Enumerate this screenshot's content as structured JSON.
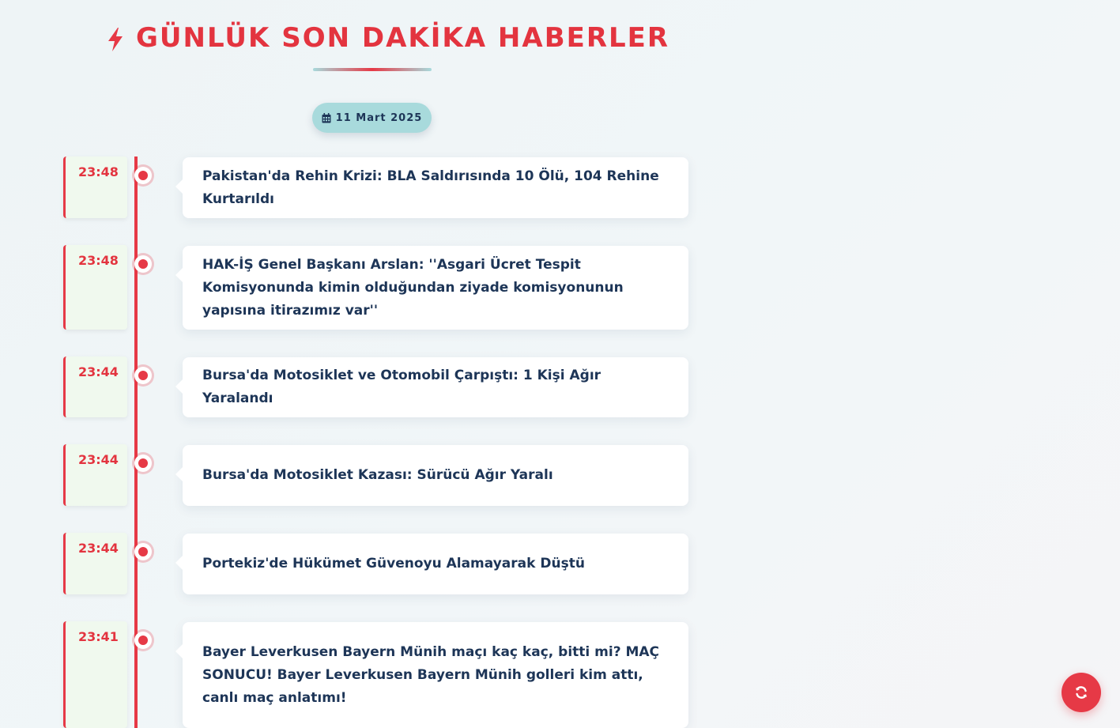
{
  "header": {
    "title": "GÜNLÜK SON DAKİKA HABERLER",
    "icon": "bolt-icon"
  },
  "date_badge": {
    "icon": "calendar-icon",
    "label": "11 Mart 2025"
  },
  "news": [
    {
      "time": "23:48",
      "headline": "Pakistan'da Rehin Krizi: BLA Saldırısında 10 Ölü, 104 Rehine Kurtarıldı"
    },
    {
      "time": "23:48",
      "headline": "HAK-İŞ Genel Başkanı Arslan: ''Asgari Ücret Tespit Komisyonunda kimin olduğundan ziyade komisyonunun yapısına itirazımız var''"
    },
    {
      "time": "23:44",
      "headline": "Bursa'da Motosiklet ve Otomobil Çarpıştı: 1 Kişi Ağır Yaralandı"
    },
    {
      "time": "23:44",
      "headline": "Bursa'da Motosiklet Kazası: Sürücü Ağır Yaralı"
    },
    {
      "time": "23:44",
      "headline": "Portekiz'de Hükümet Güvenoyu Alamayarak Düştü"
    },
    {
      "time": "23:41",
      "headline": "Bayer Leverkusen Bayern Münih maçı kaç kaç, bitti mi? MAÇ SONUCU! Bayer Leverkusen Bayern Münih golleri kim attı, canlı maç anlatımı!"
    }
  ],
  "refresh_button": {
    "icon": "refresh-icon"
  },
  "colors": {
    "accent": "#e63946",
    "navy": "#1d3557",
    "teal": "#a8dadc",
    "time_bg": "#f0f9ee"
  }
}
